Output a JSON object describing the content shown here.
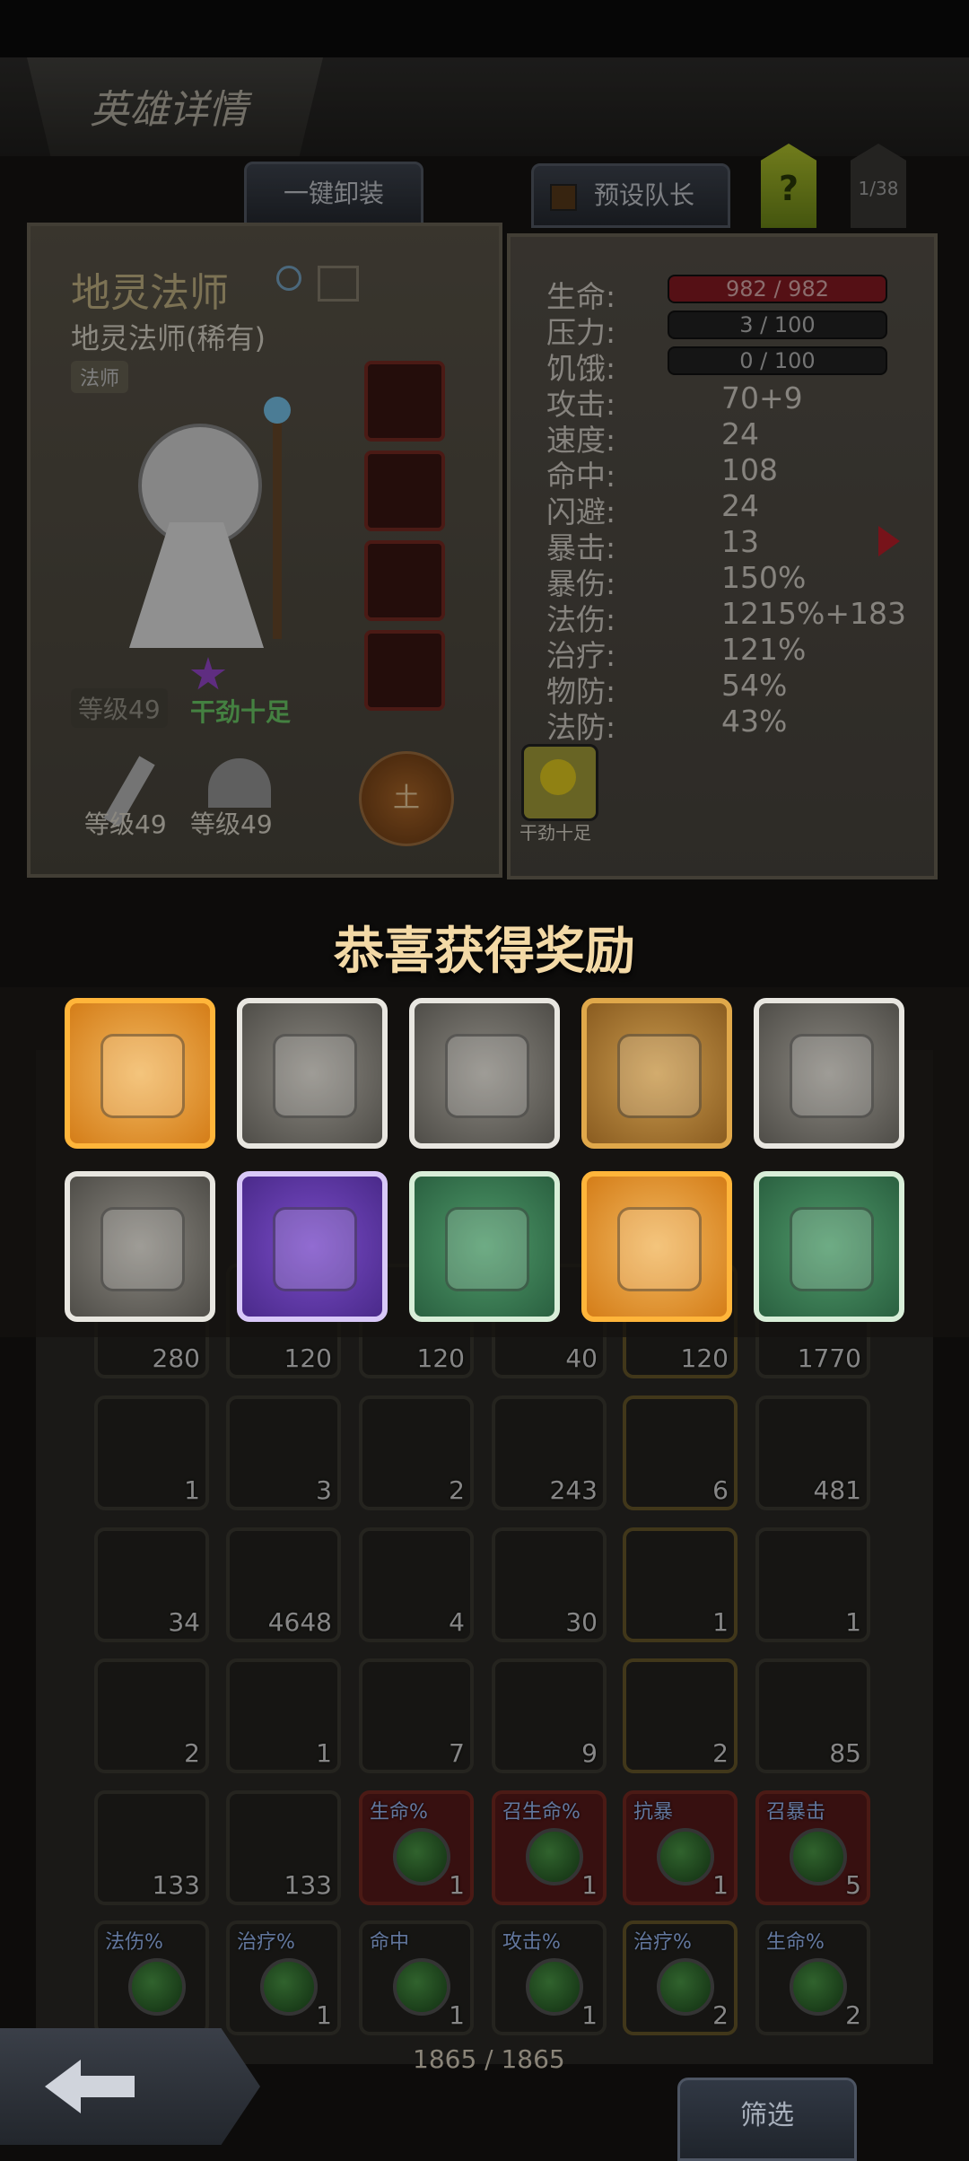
{
  "header": {
    "title": "英雄详情"
  },
  "toolbar": {
    "unequip_all": "一键卸装",
    "preset_captain": "预设队长",
    "help": "?",
    "page": "1/38"
  },
  "hero": {
    "name": "地灵法师",
    "subtitle": "地灵法师(稀有)",
    "class_tag": "法师",
    "level": "等级49",
    "mood": "干劲十足",
    "weapon_level": "等级49",
    "armor_level": "等级49",
    "element": "土",
    "buff_label": "干劲十足"
  },
  "stats": {
    "hp": {
      "label": "生命:",
      "value": "982 / 982"
    },
    "stress": {
      "label": "压力:",
      "value": "3 / 100"
    },
    "hunger": {
      "label": "饥饿:",
      "value": "0 / 100"
    },
    "rows": [
      {
        "label": "攻击:",
        "value": "70+9"
      },
      {
        "label": "速度:",
        "value": "24"
      },
      {
        "label": "命中:",
        "value": "108"
      },
      {
        "label": "闪避:",
        "value": "24"
      },
      {
        "label": "暴击:",
        "value": "13"
      },
      {
        "label": "暴伤:",
        "value": "150%"
      },
      {
        "label": "法伤:",
        "value": "1215%+183"
      },
      {
        "label": "治疗:",
        "value": "121%"
      },
      {
        "label": "物防:",
        "value": "54%"
      },
      {
        "label": "法防:",
        "value": "43%"
      }
    ]
  },
  "reward": {
    "title": "恭喜获得奖励",
    "items": [
      {
        "icon": "medkit-icon",
        "rarity": "orange"
      },
      {
        "icon": "spellbook-icon",
        "rarity": "white"
      },
      {
        "icon": "spellbook-icon",
        "rarity": "white"
      },
      {
        "icon": "crystal-helmet-icon",
        "rarity": "gold"
      },
      {
        "icon": "sword-icon",
        "rarity": "white"
      },
      {
        "icon": "boots-icon",
        "rarity": "white"
      },
      {
        "icon": "dark-armor-icon",
        "rarity": "purple"
      },
      {
        "icon": "plate-armor-icon",
        "rarity": "green"
      },
      {
        "icon": "axe-icon",
        "rarity": "orange"
      },
      {
        "icon": "ring-icon",
        "rarity": "green"
      }
    ]
  },
  "inventory": {
    "rows": [
      [
        "280",
        "120",
        "120",
        "40",
        "120",
        "1770"
      ],
      [
        "1",
        "3",
        "2",
        "243",
        "6",
        "481"
      ],
      [
        "34",
        "4648",
        "4",
        "30",
        "1",
        "1"
      ],
      [
        "2",
        "1",
        "7",
        "9",
        "2",
        "85"
      ],
      [
        "133",
        "133",
        "1",
        "1",
        "1",
        "5"
      ],
      [
        "",
        "1",
        "1",
        "1",
        "2",
        "2"
      ]
    ],
    "tags_row5": [
      "",
      "",
      "生命%",
      "召生命%",
      "抗暴",
      "召暴击"
    ],
    "tags_row6": [
      "法伤%",
      "治疗%",
      "命中",
      "攻击%",
      "治疗%",
      "生命%"
    ],
    "count": "1865 / 1865"
  },
  "footer": {
    "filter": "筛选"
  }
}
